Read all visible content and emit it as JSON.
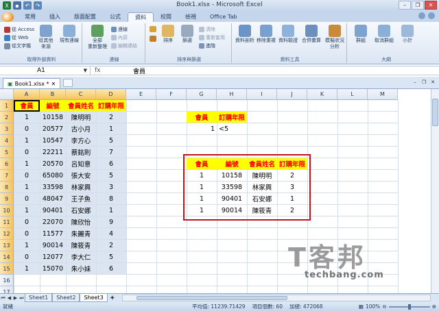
{
  "window": {
    "title": "Book1.xlsx - Microsoft Excel"
  },
  "ribbon": {
    "tabs": [
      "常用",
      "插入",
      "版面配置",
      "公式",
      "資料",
      "校閱",
      "檢視",
      "Office Tab"
    ],
    "active_tab": "資料",
    "groups": {
      "external": {
        "label": "取得外部資料",
        "items": [
          "從 Access",
          "從 Web",
          "從文字檔",
          "從其他",
          "來源",
          "現有連線"
        ]
      },
      "connections": {
        "label": "連線",
        "items": [
          "全部",
          "重新整理",
          "連線",
          "內容",
          "編輯連結"
        ]
      },
      "sort": {
        "label": "排序與篩選",
        "items": [
          "排序",
          "篩選",
          "清除",
          "重新套用",
          "進階"
        ]
      },
      "tools": {
        "label": "資料工具",
        "items": [
          "資料剖析",
          "移除重複",
          "資料驗證",
          "合併彙算",
          "模擬狀況",
          "分析"
        ]
      },
      "outline": {
        "label": "大綱",
        "items": [
          "群組",
          "取消群組",
          "小計"
        ]
      }
    }
  },
  "formula_bar": {
    "name_box": "A1",
    "fx": "fx",
    "content": "會員"
  },
  "workbook_tab": {
    "name": "Book1.xlsx *"
  },
  "columns": [
    "A",
    "B",
    "C",
    "D",
    "E",
    "F",
    "G",
    "H",
    "I",
    "J",
    "K",
    "L",
    "M"
  ],
  "rows": [
    "1",
    "2",
    "3",
    "4",
    "5",
    "6",
    "7",
    "8",
    "9",
    "10",
    "11",
    "12",
    "13",
    "14",
    "15",
    "16",
    "17"
  ],
  "table_main": {
    "headers": [
      "會員",
      "編號",
      "會員姓名",
      "訂購年限"
    ],
    "rows": [
      [
        "1",
        "10158",
        "陳明明",
        "2"
      ],
      [
        "0",
        "20577",
        "古小月",
        "1"
      ],
      [
        "1",
        "10547",
        "李方心",
        "5"
      ],
      [
        "0",
        "22211",
        "蔡銘則",
        "7"
      ],
      [
        "1",
        "20570",
        "呂知意",
        "6"
      ],
      [
        "0",
        "65080",
        "張大安",
        "5"
      ],
      [
        "1",
        "33598",
        "林家興",
        "3"
      ],
      [
        "0",
        "48047",
        "王子魚",
        "8"
      ],
      [
        "1",
        "90401",
        "石安娜",
        "1"
      ],
      [
        "0",
        "22070",
        "陳欣怡",
        "9"
      ],
      [
        "0",
        "11577",
        "朱麗青",
        "4"
      ],
      [
        "1",
        "90014",
        "陳筱青",
        "2"
      ],
      [
        "0",
        "12077",
        "李大仁",
        "5"
      ],
      [
        "1",
        "15070",
        "朱小妹",
        "6"
      ]
    ]
  },
  "criteria": {
    "headers": [
      "會員",
      "訂購年限"
    ],
    "values": [
      "1",
      "<5"
    ]
  },
  "table_result": {
    "headers": [
      "會員",
      "編號",
      "會員姓名",
      "訂購年限"
    ],
    "rows": [
      [
        "1",
        "10158",
        "陳明明",
        "2"
      ],
      [
        "1",
        "33598",
        "林家興",
        "3"
      ],
      [
        "1",
        "90401",
        "石安娜",
        "1"
      ],
      [
        "1",
        "90014",
        "陳筱青",
        "2"
      ]
    ]
  },
  "sheet_tabs": [
    "Sheet1",
    "Sheet2",
    "Sheet3"
  ],
  "active_sheet": "Sheet3",
  "status": {
    "mode": "就緒",
    "average": "平均值: 11239.71429",
    "count": "項目個數: 60",
    "sum": "加總: 472068",
    "zoom": "100%"
  },
  "watermark": {
    "big": "T客邦",
    "small": "techbang.com"
  },
  "colors": {
    "header_fill": "#ffff00",
    "header_text": "#ff0000",
    "highlight_box": "#c0141b",
    "data_fill": "#dbe5f1"
  }
}
